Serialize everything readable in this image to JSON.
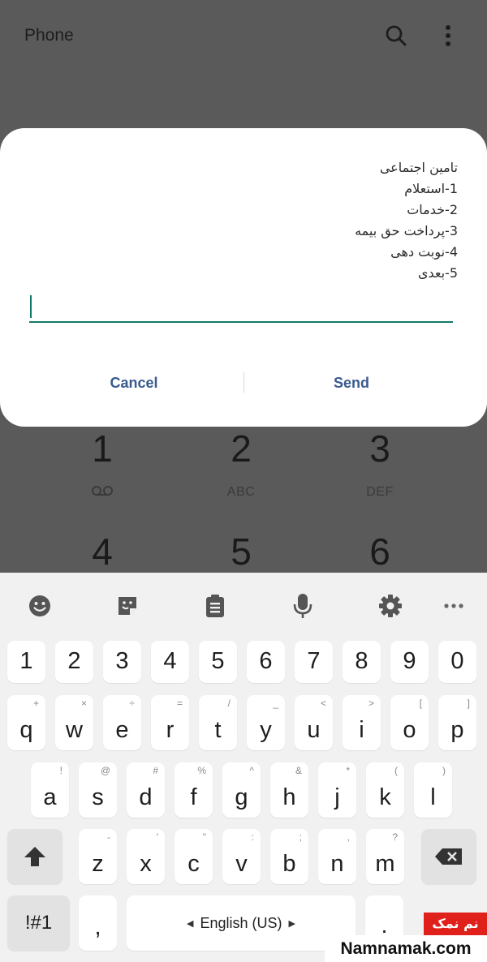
{
  "appbar": {
    "title": "Phone",
    "search_icon": "search-icon",
    "more_icon": "more-vert-icon"
  },
  "dialpad": {
    "keys": [
      {
        "digit": "1",
        "sub": "voicemail-icon"
      },
      {
        "digit": "2",
        "sub": "ABC"
      },
      {
        "digit": "3",
        "sub": "DEF"
      },
      {
        "digit": "4",
        "sub": ""
      },
      {
        "digit": "5",
        "sub": ""
      },
      {
        "digit": "6",
        "sub": ""
      }
    ]
  },
  "dialog": {
    "message_lines": [
      "تامین اجتماعی",
      "1-استعلام",
      "2-خدمات",
      "3-پرداخت حق بیمه",
      "4-نوبت دهی",
      "5-بعدی"
    ],
    "input_value": "",
    "cancel_label": "Cancel",
    "send_label": "Send",
    "accent_color": "#127a6c",
    "button_color": "#385b8e"
  },
  "keyboard": {
    "toolbar": [
      "emoji-icon",
      "sticker-icon",
      "clipboard-icon",
      "microphone-icon",
      "settings-icon",
      "more-horiz-icon"
    ],
    "number_row": [
      "1",
      "2",
      "3",
      "4",
      "5",
      "6",
      "7",
      "8",
      "9",
      "0"
    ],
    "row1": [
      {
        "key": "q",
        "hint": "+"
      },
      {
        "key": "w",
        "hint": "×"
      },
      {
        "key": "e",
        "hint": "÷"
      },
      {
        "key": "r",
        "hint": "="
      },
      {
        "key": "t",
        "hint": "/"
      },
      {
        "key": "y",
        "hint": "_"
      },
      {
        "key": "u",
        "hint": "<"
      },
      {
        "key": "i",
        "hint": ">"
      },
      {
        "key": "o",
        "hint": "["
      },
      {
        "key": "p",
        "hint": "]"
      }
    ],
    "row2": [
      {
        "key": "a",
        "hint": "!"
      },
      {
        "key": "s",
        "hint": "@"
      },
      {
        "key": "d",
        "hint": "#"
      },
      {
        "key": "f",
        "hint": "%"
      },
      {
        "key": "g",
        "hint": "^"
      },
      {
        "key": "h",
        "hint": "&"
      },
      {
        "key": "j",
        "hint": "*"
      },
      {
        "key": "k",
        "hint": "("
      },
      {
        "key": "l",
        "hint": ")"
      }
    ],
    "row3": [
      {
        "key": "z",
        "hint": "-"
      },
      {
        "key": "x",
        "hint": "'"
      },
      {
        "key": "c",
        "hint": "\""
      },
      {
        "key": "v",
        "hint": ":"
      },
      {
        "key": "b",
        "hint": ";"
      },
      {
        "key": "n",
        "hint": ","
      },
      {
        "key": "m",
        "hint": "?"
      }
    ],
    "symbols_label": "!#1",
    "comma_label": ",",
    "space_label": "English (US)",
    "period_label": "."
  },
  "watermark": {
    "persian": "نم نمک",
    "site": "Namnamak.com",
    "color": "#e0201b"
  }
}
